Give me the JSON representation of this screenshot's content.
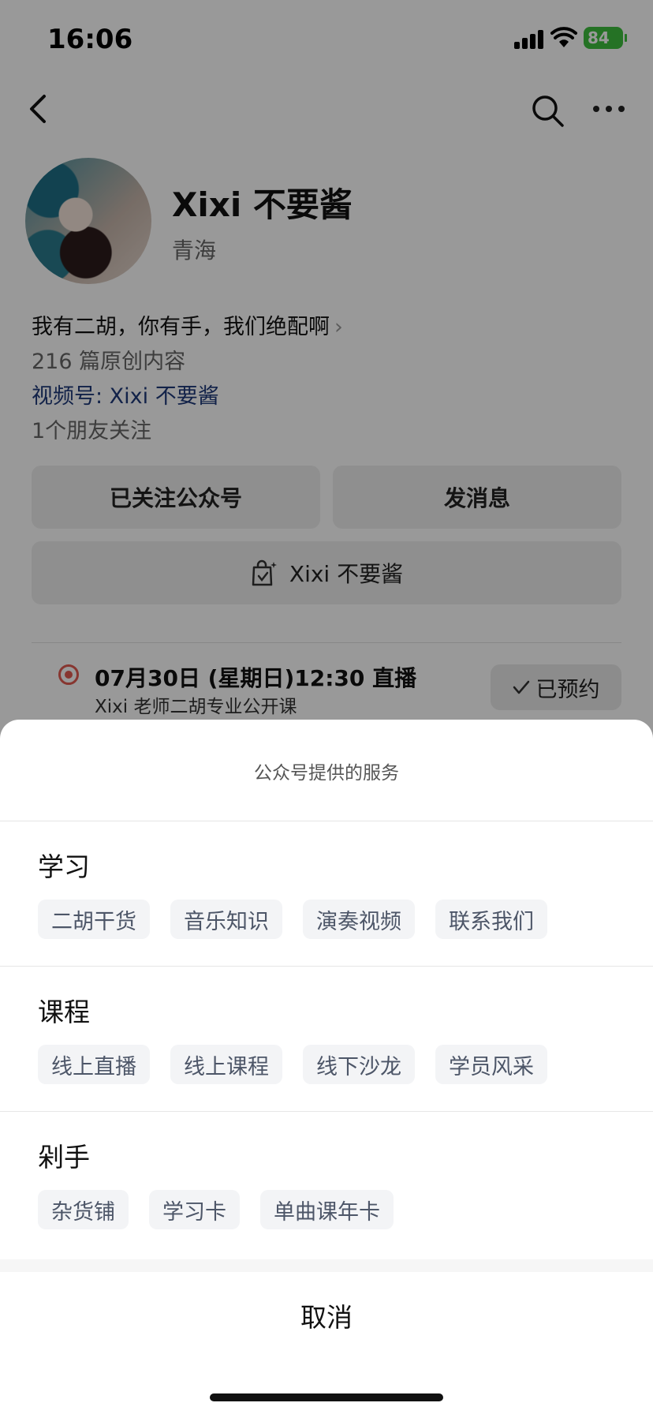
{
  "status_bar": {
    "time": "16:06",
    "battery": "84"
  },
  "profile": {
    "name": "Xixi 不要酱",
    "region": "青海",
    "bio": "我有二胡，你有手，我们绝配啊",
    "articles": "216 篇原创内容",
    "channel": "视频号: Xixi 不要酱",
    "friends": "1个朋友关注"
  },
  "buttons": {
    "follow": "已关注公众号",
    "message": "发消息",
    "shop": "Xixi 不要酱"
  },
  "live": {
    "time": "07月30日 (星期日)12:30 直播",
    "title": "Xixi 老师二胡专业公开课",
    "reserved": "已预约"
  },
  "sheet": {
    "title": "公众号提供的服务",
    "sections": [
      {
        "title": "学习",
        "items": [
          "二胡干货",
          "音乐知识",
          "演奏视频",
          "联系我们"
        ]
      },
      {
        "title": "课程",
        "items": [
          "线上直播",
          "线上课程",
          "线下沙龙",
          "学员风采"
        ]
      },
      {
        "title": "剁手",
        "items": [
          "杂货铺",
          "学习卡",
          "单曲课年卡"
        ]
      }
    ],
    "cancel": "取消"
  },
  "colors": {
    "channel_link": "#1f3a7a",
    "live_dot": "#e15b50",
    "battery": "#3fbf3f",
    "chip_text": "#4d5668"
  },
  "icons": [
    "back-arrow-icon",
    "search-icon",
    "more-icon",
    "shop-bag-icon",
    "live-dot-icon",
    "check-icon",
    "chevron-right-icon"
  ]
}
